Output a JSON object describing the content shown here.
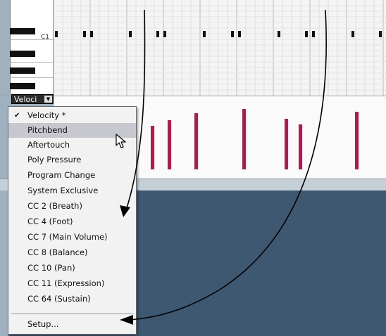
{
  "keyboard": {
    "c1_label": "C1"
  },
  "controller_lane": {
    "selected_label": "Veloci"
  },
  "menu": {
    "items": [
      {
        "label": "Velocity *",
        "checked": true
      },
      {
        "label": "Pitchbend",
        "highlighted": true
      },
      {
        "label": "Aftertouch"
      },
      {
        "label": "Poly Pressure"
      },
      {
        "label": "Program Change"
      },
      {
        "label": "System Exclusive"
      },
      {
        "label": "CC 2  (Breath)"
      },
      {
        "label": "CC 4  (Foot)"
      },
      {
        "label": "CC 7  (Main Volume)"
      },
      {
        "label": "CC 8  (Balance)"
      },
      {
        "label": "CC 10  (Pan)"
      },
      {
        "label": "CC 11  (Expression)"
      },
      {
        "label": "CC 64  (Sustain)"
      }
    ],
    "setup_label": "Setup..."
  },
  "colors": {
    "velocity_bar": "#a6204a",
    "panel_blue": "#3e5872",
    "menu_highlight": "#c7c7cf"
  }
}
